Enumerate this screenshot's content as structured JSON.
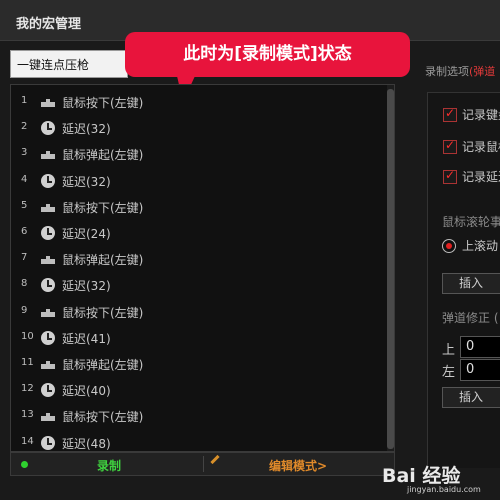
{
  "window": {
    "title": "我的宏管理"
  },
  "macro_select": {
    "value": "一键连点压枪"
  },
  "callout": {
    "text": "此时为[录制模式]状态"
  },
  "right_header": {
    "label": "录制选项",
    "accent": "(弹道"
  },
  "macro_steps": [
    {
      "num": "1",
      "icon": "mouse-icon",
      "label": "鼠标按下(左键)"
    },
    {
      "num": "2",
      "icon": "clock-icon",
      "label": "延迟(32)"
    },
    {
      "num": "3",
      "icon": "mouse-icon",
      "label": "鼠标弹起(左键)"
    },
    {
      "num": "4",
      "icon": "clock-icon",
      "label": "延迟(32)"
    },
    {
      "num": "5",
      "icon": "mouse-icon",
      "label": "鼠标按下(左键)"
    },
    {
      "num": "6",
      "icon": "clock-icon",
      "label": "延迟(24)"
    },
    {
      "num": "7",
      "icon": "mouse-icon",
      "label": "鼠标弹起(左键)"
    },
    {
      "num": "8",
      "icon": "clock-icon",
      "label": "延迟(32)"
    },
    {
      "num": "9",
      "icon": "mouse-icon",
      "label": "鼠标按下(左键)"
    },
    {
      "num": "10",
      "icon": "clock-icon",
      "label": "延迟(41)"
    },
    {
      "num": "11",
      "icon": "mouse-icon",
      "label": "鼠标弹起(左键)"
    },
    {
      "num": "12",
      "icon": "clock-icon",
      "label": "延迟(40)"
    },
    {
      "num": "13",
      "icon": "mouse-icon",
      "label": "鼠标按下(左键)"
    },
    {
      "num": "14",
      "icon": "clock-icon",
      "label": "延迟(48)"
    }
  ],
  "bottom_bar": {
    "record_label": "录制",
    "edit_label": "编辑模式>"
  },
  "options": {
    "checkboxes": [
      {
        "label": "记录键盘",
        "checked": true
      },
      {
        "label": "记录鼠标",
        "checked": true
      },
      {
        "label": "记录延迟",
        "checked": true
      }
    ],
    "wheel_label": "鼠标滚轮事",
    "radio_label": "上滚动",
    "insert_label": "插入",
    "trajectory_label": "弹道修正 (",
    "up_label": "上",
    "up_value": "0",
    "left_label": "左",
    "left_value": "0",
    "insert_label_2": "插入"
  },
  "watermark": {
    "logo": "Bai 经验",
    "url": "jingyan.baidu.com"
  },
  "colors": {
    "accent_red": "#e8143c",
    "record_green": "#3fd03f",
    "edit_orange": "#e08a2a"
  }
}
